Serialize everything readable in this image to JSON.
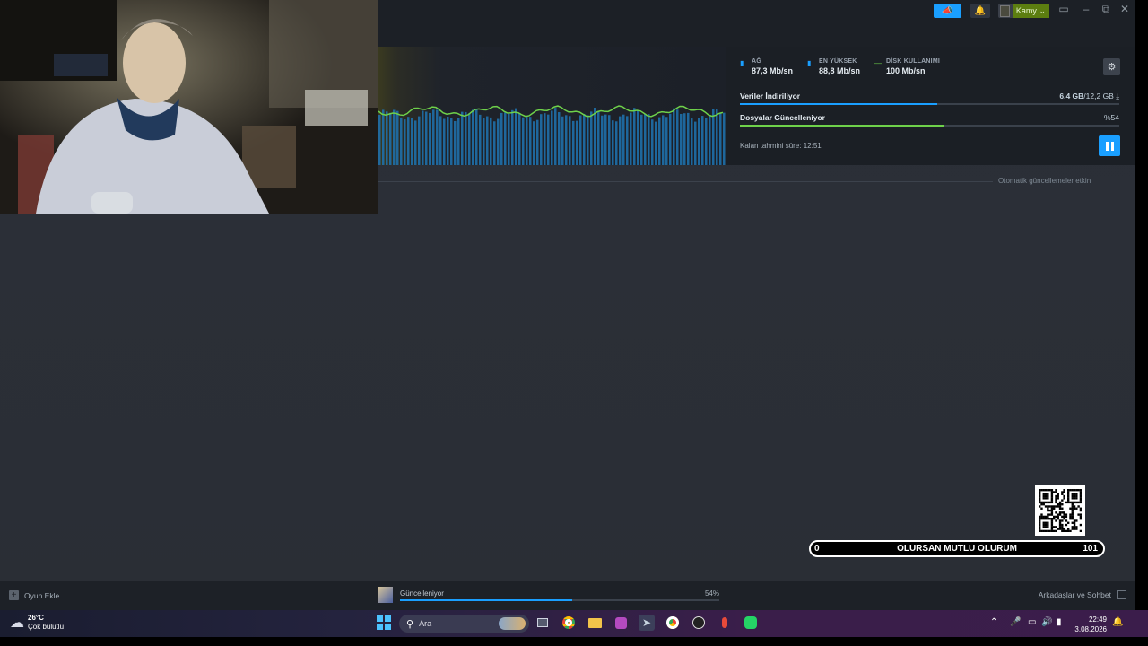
{
  "topbar": {
    "username": "Kamy",
    "window_controls": [
      "minimize",
      "restore",
      "close"
    ]
  },
  "download": {
    "stats": [
      {
        "label": "AĞ",
        "value": "87,3 Mb/sn",
        "icon": "bar-chart-icon",
        "color": "#1a9fff"
      },
      {
        "label": "EN YÜKSEK",
        "value": "88,8 Mb/sn",
        "icon": "bar-chart-icon",
        "color": "#1a9fff"
      },
      {
        "label": "DİSK KULLANIMI",
        "value": "100 Mb/sn",
        "icon": "line-icon",
        "color": "#6ed14a"
      }
    ],
    "download_label": "Veriler İndiriliyor",
    "download_progress": "6,4 GB",
    "download_total": "/12,2 GB",
    "download_fraction": 0.52,
    "update_label": "Dosyalar Güncelleniyor",
    "update_percent": "%54",
    "update_fraction": 0.54,
    "eta": "Kalan tahmini süre: 12:51",
    "auto_updates": "Otomatik güncellemeler etkin"
  },
  "bottombar": {
    "add_game": "Oyun Ekle",
    "update_status": "Güncelleniyor",
    "update_percent": "54%",
    "update_fraction": 0.54,
    "friends": "Arkadaşlar ve Sohbet"
  },
  "overlay": {
    "left": "0",
    "title": "OLURSAN MUTLU OLURUM",
    "right": "101"
  },
  "taskbar": {
    "temperature": "26°C",
    "weather": "Çok bulutlu",
    "search_placeholder": "Ara",
    "time": "22:49",
    "date": "3.08.2026",
    "icons": [
      "windows-start-icon",
      "task-view-icon",
      "chrome-icon",
      "file-explorer-icon",
      "app-icon",
      "steam-icon",
      "chrome-alt-icon",
      "obs-icon",
      "microphone-app-icon",
      "whatsapp-icon"
    ]
  },
  "colors": {
    "accent": "#1a9fff",
    "disk_green": "#6ed14a",
    "user_green": "#5c7e10"
  }
}
